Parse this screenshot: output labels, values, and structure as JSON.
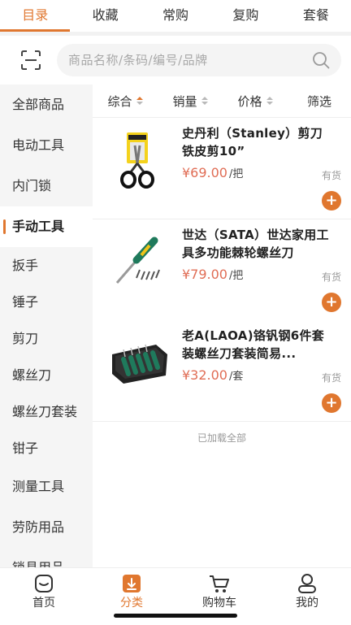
{
  "top_tabs": [
    "目录",
    "收藏",
    "常购",
    "复购",
    "套餐"
  ],
  "search": {
    "placeholder": "商品名称/条码/编号/品牌"
  },
  "sidebar": {
    "items": [
      "全部商品",
      "电动工具",
      "内门锁",
      "手动工具",
      "扳手",
      "锤子",
      "剪刀",
      "螺丝刀",
      "螺丝刀套装",
      "钳子",
      "测量工具",
      "劳防用品",
      "锁具用品"
    ],
    "active_index": 3
  },
  "sort_bar": {
    "items": [
      "综合",
      "销量",
      "价格",
      "筛选"
    ]
  },
  "products": [
    {
      "title": "史丹利（Stanley）剪刀 铁皮剪10”",
      "price": "¥69.00",
      "unit": "/把",
      "stock": "有货"
    },
    {
      "title": "世达（SATA）世达家用工具多功能棘轮螺丝刀",
      "price": "¥79.00",
      "unit": "/把",
      "stock": "有货"
    },
    {
      "title": "老A(LAOA)铬钒钢6件套装螺丝刀套装简易...",
      "price": "¥32.00",
      "unit": "/套",
      "stock": "有货"
    }
  ],
  "loaded_all": "已加载全部",
  "bottom_nav": [
    "首页",
    "分类",
    "购物车",
    "我的"
  ],
  "colors": {
    "accent": "#e0772f",
    "price": "#e06d55"
  }
}
